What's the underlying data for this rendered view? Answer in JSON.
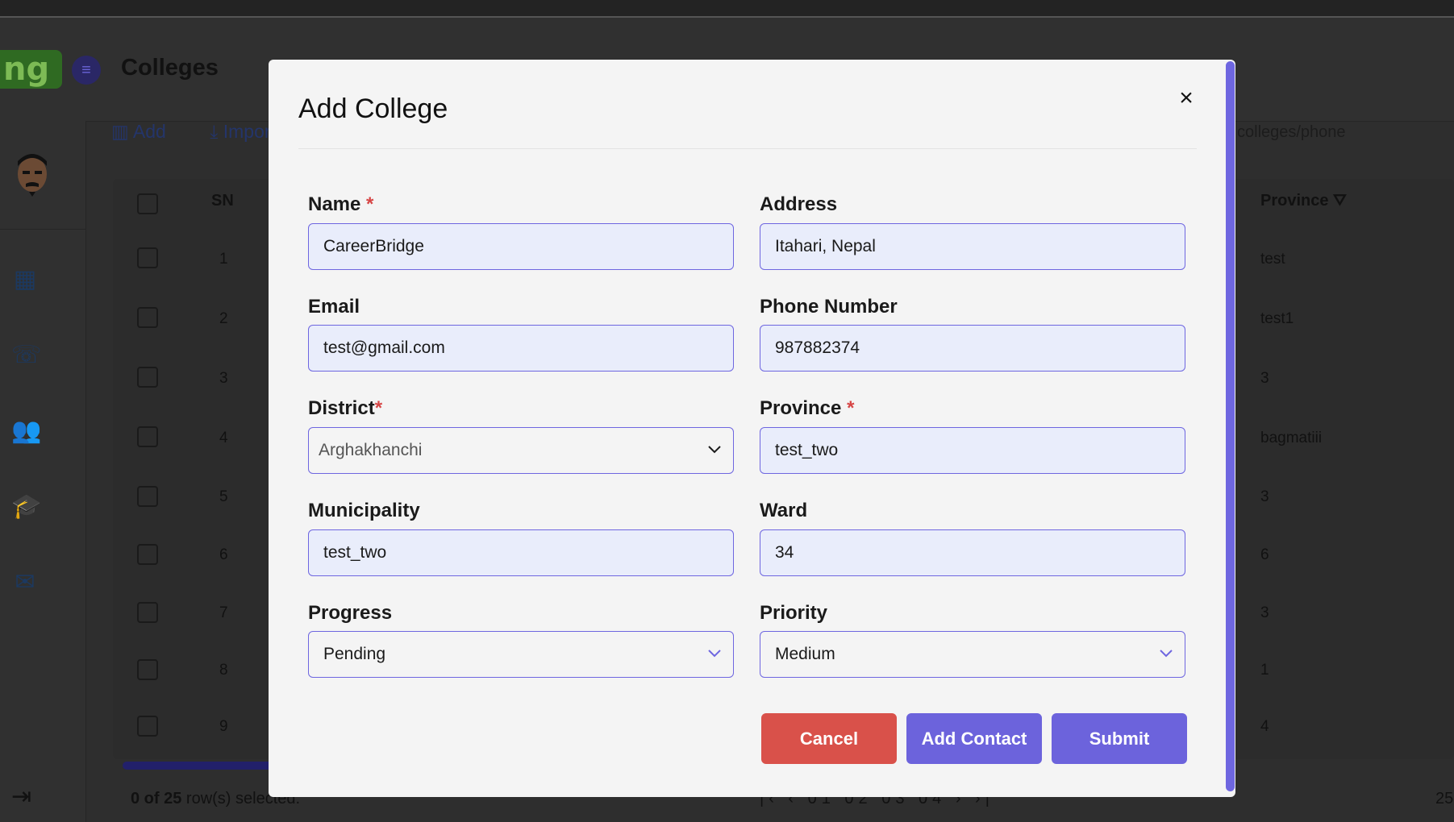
{
  "app": {
    "page_title": "Colleges",
    "logo_text": "ng",
    "toolbar": {
      "add_label": "Add",
      "import_label": "Impor"
    },
    "route_label": "colleges/phone"
  },
  "table": {
    "headers": {
      "sn": "SN",
      "province": "Province"
    },
    "rows": [
      {
        "sn": "1",
        "province": "test"
      },
      {
        "sn": "2",
        "province": "test1"
      },
      {
        "sn": "3",
        "province": "3"
      },
      {
        "sn": "4",
        "province": "bagmatiii"
      },
      {
        "sn": "5",
        "province": "3"
      },
      {
        "sn": "6",
        "province": "6"
      },
      {
        "sn": "7",
        "province": "3"
      },
      {
        "sn": "8",
        "province": "1"
      },
      {
        "sn": "9",
        "province": "4"
      }
    ],
    "footer": {
      "selected_count": "0 of 25",
      "selected_suffix": " row(s) selected.",
      "pages": "|‹ ‹ 01 02 03 04 › ›|",
      "rows_per_page": "25"
    }
  },
  "modal": {
    "title": "Add College",
    "fields": {
      "name": {
        "label": "Name",
        "required_mark": "*",
        "value": "CareerBridge"
      },
      "address": {
        "label": "Address",
        "value": "Itahari, Nepal"
      },
      "email": {
        "label": "Email",
        "value": "test@gmail.com"
      },
      "phone": {
        "label": "Phone Number",
        "value": "987882374"
      },
      "district": {
        "label": "District",
        "required_mark": "*",
        "value": "Arghakhanchi"
      },
      "province": {
        "label": "Province",
        "required_mark": "*",
        "value": "test_two"
      },
      "municipality": {
        "label": "Municipality",
        "value": "test_two"
      },
      "ward": {
        "label": "Ward",
        "value": "34"
      },
      "progress": {
        "label": "Progress",
        "value": "Pending"
      },
      "priority": {
        "label": "Priority",
        "value": "Medium"
      }
    },
    "buttons": {
      "cancel": "Cancel",
      "add_contact": "Add Contact",
      "submit": "Submit"
    }
  },
  "colors": {
    "accent": "#6c63dc",
    "danger": "#d9514a",
    "field_bg": "#e9edfb"
  }
}
